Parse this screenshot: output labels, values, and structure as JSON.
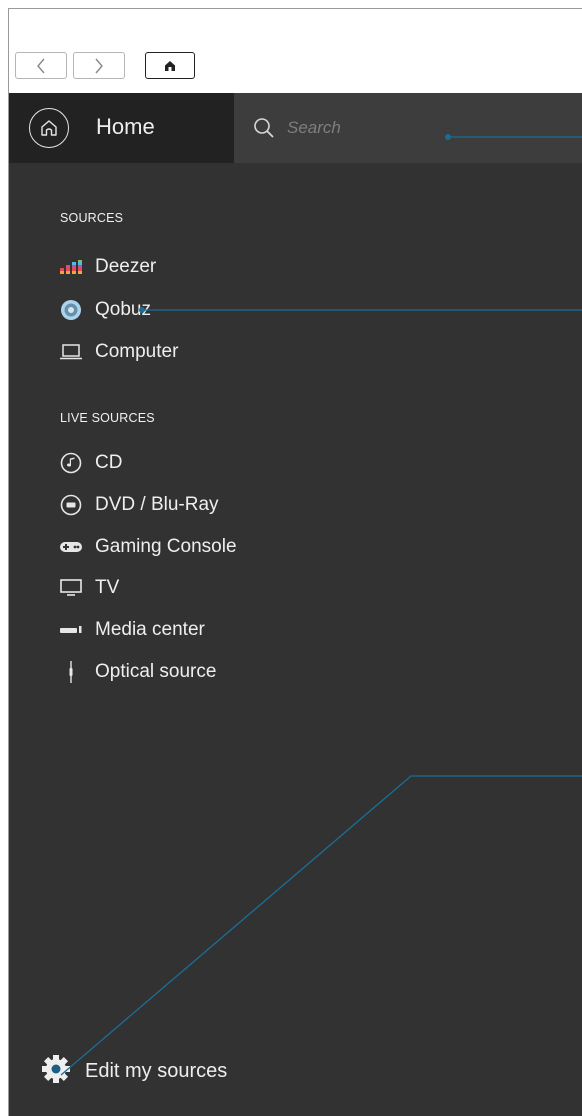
{
  "header": {
    "home_label": "Home",
    "search_placeholder": "Search"
  },
  "sources": {
    "title": "SOURCES",
    "items": [
      {
        "label": "Deezer",
        "icon": "deezer-icon"
      },
      {
        "label": "Qobuz",
        "icon": "qobuz-icon"
      },
      {
        "label": "Computer",
        "icon": "laptop-icon"
      }
    ]
  },
  "live_sources": {
    "title": "LIVE SOURCES",
    "items": [
      {
        "label": "CD",
        "icon": "cd-icon"
      },
      {
        "label": "DVD / Blu-Ray",
        "icon": "disc-icon"
      },
      {
        "label": "Gaming Console",
        "icon": "gamepad-icon"
      },
      {
        "label": "TV",
        "icon": "tv-icon"
      },
      {
        "label": "Media center",
        "icon": "media-center-icon"
      },
      {
        "label": "Optical source",
        "icon": "optical-cable-icon"
      }
    ]
  },
  "footer": {
    "edit_label": "Edit my sources"
  },
  "colors": {
    "background": "#323232",
    "header_home_bg": "#222222",
    "search_bg": "#3d3d3d",
    "annotation_line": "#1a6e96",
    "text": "#eeeeee"
  }
}
